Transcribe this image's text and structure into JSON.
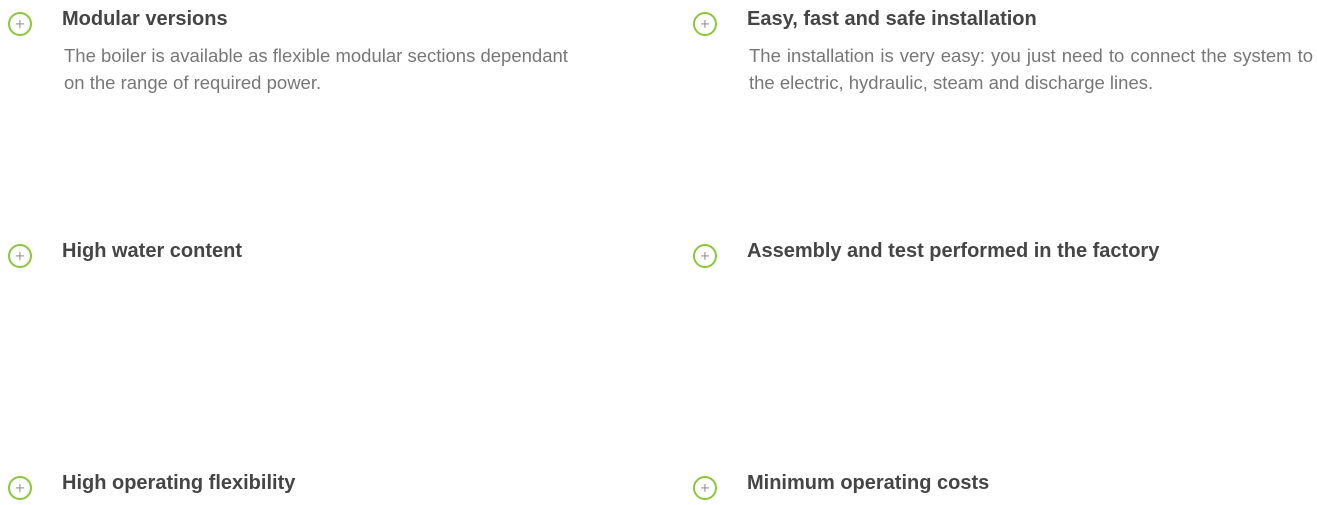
{
  "accent_color": "#8cc63f",
  "features": [
    {
      "title": "Modular versions",
      "description": "The boiler is available as flexible modular sections dependant on the range of required power.",
      "icon": "plus-circle-icon"
    },
    {
      "title": "Easy, fast and safe installation",
      "description": "The installation is very easy: you just need to connect the system to the electric, hydraulic, steam and discharge lines.",
      "icon": "plus-circle-icon"
    },
    {
      "title": "High water content",
      "description": "",
      "icon": "plus-circle-icon"
    },
    {
      "title": "Assembly and test performed in the factory",
      "description": "",
      "icon": "plus-circle-icon"
    },
    {
      "title": "High operating flexibility",
      "description": "",
      "icon": "plus-circle-icon"
    },
    {
      "title": "Minimum operating costs",
      "description": "",
      "icon": "plus-circle-icon"
    }
  ]
}
